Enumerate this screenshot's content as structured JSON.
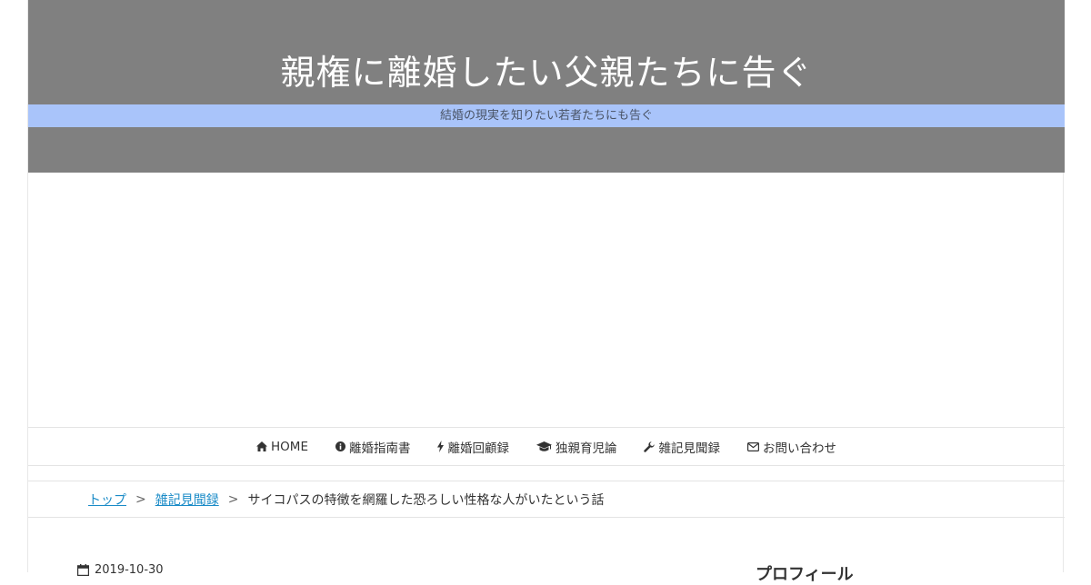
{
  "header": {
    "site_title": "親権に離婚したい父親たちに告ぐ",
    "tagline": "結婚の現実を知りたい若者たちにも告ぐ",
    "bg_color": "#808080",
    "tagline_bg_color": "#a9c4fa"
  },
  "nav": {
    "items": [
      {
        "label": "HOME",
        "icon": "home-icon"
      },
      {
        "label": "離婚指南書",
        "icon": "info-circle-icon"
      },
      {
        "label": "離婚回顧録",
        "icon": "bolt-icon"
      },
      {
        "label": "独親育児論",
        "icon": "graduation-cap-icon"
      },
      {
        "label": "雑記見聞録",
        "icon": "wrench-icon"
      },
      {
        "label": "お問い合わせ",
        "icon": "envelope-icon"
      }
    ]
  },
  "breadcrumb": {
    "top": "トップ",
    "category": "雑記見聞録",
    "current": "サイコパスの特徴を網羅した恐ろしい性格な人がいたという話",
    "separator": ">",
    "link_color": "#1a8bc7"
  },
  "post": {
    "date": "2019-10-30",
    "date_icon": "calendar-icon"
  },
  "sidebar": {
    "heading": "プロフィール"
  }
}
